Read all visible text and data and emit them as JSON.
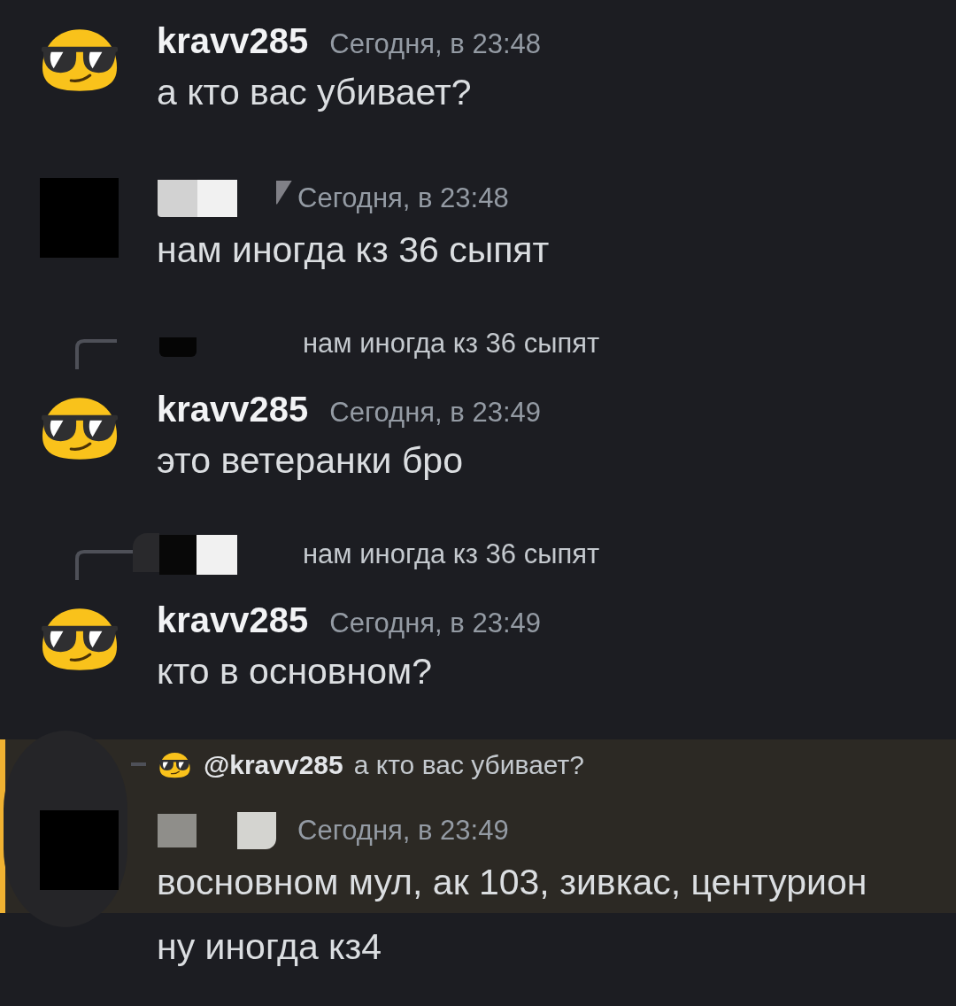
{
  "messages": [
    {
      "kind": "full",
      "author": {
        "kind": "user",
        "name": "kravv285"
      },
      "timestamp": "Сегодня, в 23:48",
      "text": "а кто вас убивает?",
      "mentioned": false
    },
    {
      "kind": "full",
      "author": {
        "kind": "redacted"
      },
      "timestamp": "Сегодня, в 23:48",
      "text": "нам иногда кз 36 сыпят",
      "mentioned": false
    },
    {
      "kind": "full",
      "reply": {
        "author": {
          "kind": "redacted"
        },
        "text": "нам иногда кз 36 сыпят"
      },
      "author": {
        "kind": "user",
        "name": "kravv285"
      },
      "timestamp": "Сегодня, в 23:49",
      "text": "это ветеранки бро",
      "mentioned": false
    },
    {
      "kind": "full",
      "reply": {
        "author": {
          "kind": "redacted"
        },
        "text": "нам иногда кз 36 сыпят"
      },
      "author": {
        "kind": "user",
        "name": "kravv285"
      },
      "timestamp": "Сегодня, в 23:49",
      "text": "кто в основном?",
      "mentioned": false
    },
    {
      "kind": "full",
      "reply": {
        "author": {
          "kind": "user",
          "name": "@kravv285"
        },
        "text": "а кто вас убивает?"
      },
      "author": {
        "kind": "redacted"
      },
      "timestamp": "Сегодня, в 23:49",
      "text": "восновном мул, ак 103, зивкас, центурион",
      "mentioned": true
    },
    {
      "kind": "continuation",
      "text": "ну иногда кз4",
      "mentioned": false
    }
  ]
}
